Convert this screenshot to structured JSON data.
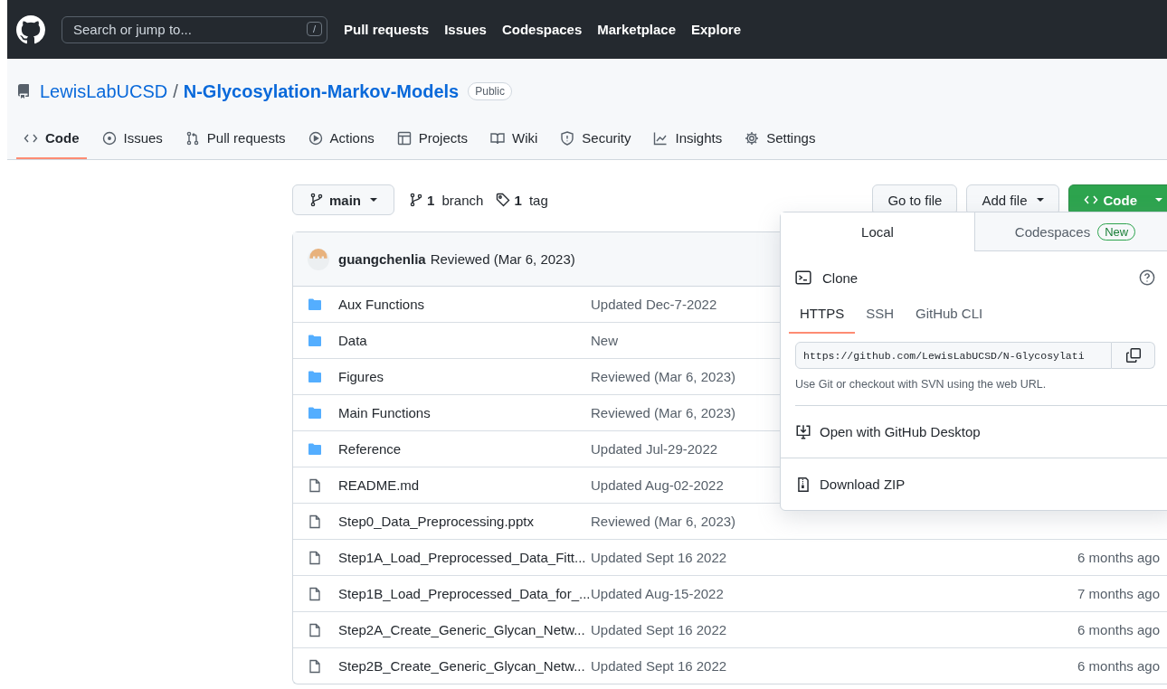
{
  "header": {
    "search_placeholder": "Search or jump to...",
    "search_key": "/",
    "nav": [
      "Pull requests",
      "Issues",
      "Codespaces",
      "Marketplace",
      "Explore"
    ]
  },
  "repo": {
    "owner": "LewisLabUCSD",
    "separator": "/",
    "name": "N-Glycosylation-Markov-Models",
    "visibility": "Public"
  },
  "tabs": [
    {
      "label": "Code",
      "selected": true
    },
    {
      "label": "Issues",
      "selected": false
    },
    {
      "label": "Pull requests",
      "selected": false
    },
    {
      "label": "Actions",
      "selected": false
    },
    {
      "label": "Projects",
      "selected": false
    },
    {
      "label": "Wiki",
      "selected": false
    },
    {
      "label": "Security",
      "selected": false
    },
    {
      "label": "Insights",
      "selected": false
    },
    {
      "label": "Settings",
      "selected": false
    }
  ],
  "toolbar": {
    "branch": "main",
    "branches_count": "1",
    "branches_label": "branch",
    "tags_count": "1",
    "tags_label": "tag",
    "go_to_file": "Go to file",
    "add_file": "Add file",
    "code": "Code"
  },
  "commit": {
    "author": "guangchenlia",
    "message": "Reviewed (Mar 6, 2023)"
  },
  "files": [
    {
      "kind": "folder",
      "name": "Aux Functions",
      "message": "Updated Dec-7-2022"
    },
    {
      "kind": "folder",
      "name": "Data",
      "message": "New"
    },
    {
      "kind": "folder",
      "name": "Figures",
      "message": "Reviewed (Mar 6, 2023)"
    },
    {
      "kind": "folder",
      "name": "Main Functions",
      "message": "Reviewed (Mar 6, 2023)"
    },
    {
      "kind": "folder",
      "name": "Reference",
      "message": "Updated Jul-29-2022"
    },
    {
      "kind": "file",
      "name": "README.md",
      "message": "Updated Aug-02-2022"
    },
    {
      "kind": "file",
      "name": "Step0_Data_Preprocessing.pptx",
      "message": "Reviewed (Mar 6, 2023)"
    },
    {
      "kind": "file",
      "name": "Step1A_Load_Preprocessed_Data_Fitt...",
      "message": "Updated Sept 16 2022",
      "age": "6 months ago"
    },
    {
      "kind": "file",
      "name": "Step1B_Load_Preprocessed_Data_for_...",
      "message": "Updated Aug-15-2022",
      "age": "7 months ago"
    },
    {
      "kind": "file",
      "name": "Step2A_Create_Generic_Glycan_Netw...",
      "message": "Updated Sept 16 2022",
      "age": "6 months ago"
    },
    {
      "kind": "file",
      "name": "Step2B_Create_Generic_Glycan_Netw...",
      "message": "Updated Sept 16 2022",
      "age": "6 months ago"
    }
  ],
  "code_menu": {
    "tabs": [
      {
        "label": "Local",
        "selected": true
      },
      {
        "label": "Codespaces",
        "badge": "New",
        "selected": false
      }
    ],
    "clone_title": "Clone",
    "protocols": [
      {
        "label": "HTTPS",
        "selected": true
      },
      {
        "label": "SSH",
        "selected": false
      },
      {
        "label": "GitHub CLI",
        "selected": false
      }
    ],
    "url": "https://github.com/LewisLabUCSD/N-Glycosylati",
    "hint": "Use Git or checkout with SVN using the web URL.",
    "actions": [
      "Open with GitHub Desktop",
      "Download ZIP"
    ]
  }
}
